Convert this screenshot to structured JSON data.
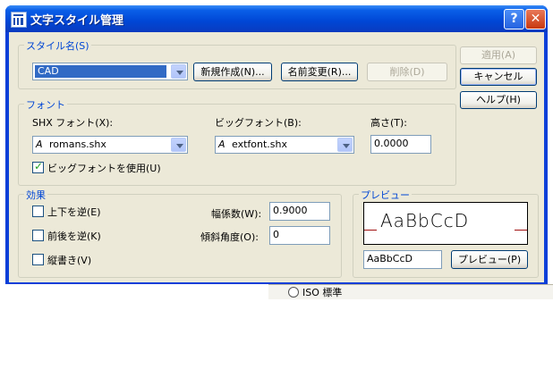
{
  "background": {
    "text": "ISO 標準"
  },
  "window": {
    "title": "文字スタイル管理",
    "help_glyph": "?",
    "close_glyph": "✕"
  },
  "style_name": {
    "group_label": "スタイル名(S)",
    "value": "CAD",
    "new_button": "新規作成(N)...",
    "rename_button": "名前変更(R)...",
    "delete_button": "削除(D)"
  },
  "side_buttons": {
    "apply": "適用(A)",
    "cancel": "キャンセル",
    "help": "ヘルプ(H)"
  },
  "font": {
    "group_label": "フォント",
    "shx_label": "SHX フォント(X):",
    "shx_value": "romans.shx",
    "big_label": "ビッグフォント(B):",
    "big_value": "extfont.shx",
    "height_label": "高さ(T):",
    "height_value": "0.0000",
    "use_big_label": "ビッグフォントを使用(U)",
    "use_big_checked": true,
    "font_glyph": "A"
  },
  "effects": {
    "group_label": "効果",
    "upside_down": "上下を逆(E)",
    "backwards": "前後を逆(K)",
    "vertical": "縦書き(V)",
    "width_label": "幅係数(W):",
    "width_value": "0.9000",
    "oblique_label": "傾斜角度(O):",
    "oblique_value": "0"
  },
  "preview": {
    "group_label": "プレビュー",
    "sample_text": "AaBbCcD",
    "input_value": "AaBbCcD",
    "button": "プレビュー(P)"
  },
  "colors": {
    "title_blue": "#0046d5",
    "client_bg": "#ece9d8",
    "group_label": "#0046d5"
  }
}
